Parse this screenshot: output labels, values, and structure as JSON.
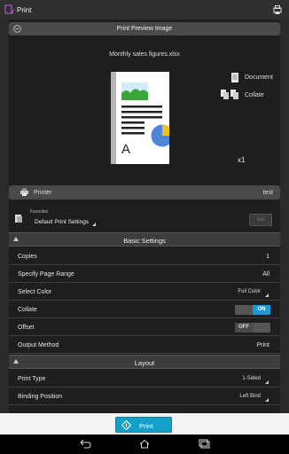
{
  "app": {
    "title": "Print",
    "icon": "print-app-icon",
    "topright_icon": "printer-status-icon"
  },
  "preview": {
    "header": "Print Preview Image",
    "filename": "Monthly sales figures.xlsx"
  },
  "output_options": {
    "document": "Document",
    "collate": "Collate",
    "copies_indicator": "x1"
  },
  "printer": {
    "label": "Printer",
    "value": "test"
  },
  "favorites": {
    "caption": "Favorites",
    "value": "Default Print Settings",
    "button": "Edit"
  },
  "basic_settings": {
    "header": "Basic Settings",
    "rows": [
      {
        "label": "Copies",
        "value": "1"
      },
      {
        "label": "Specify Page Range",
        "value": "All"
      },
      {
        "label": "Select Color",
        "value": "Full Color"
      },
      {
        "label": "Collate",
        "value": "ON"
      },
      {
        "label": "Offset",
        "value": "OFF"
      },
      {
        "label": "Output Method",
        "value": "Print"
      }
    ]
  },
  "layout": {
    "header": "Layout",
    "rows": [
      {
        "label": "Print Type",
        "value": "1-Sided"
      },
      {
        "label": "Binding Position",
        "value": "Left Bind"
      }
    ]
  },
  "print_button": {
    "label": "Print"
  },
  "colors": {
    "accent": "#1b9ad6",
    "print_button": "#13a0c9",
    "background": "#2b2b2b"
  }
}
